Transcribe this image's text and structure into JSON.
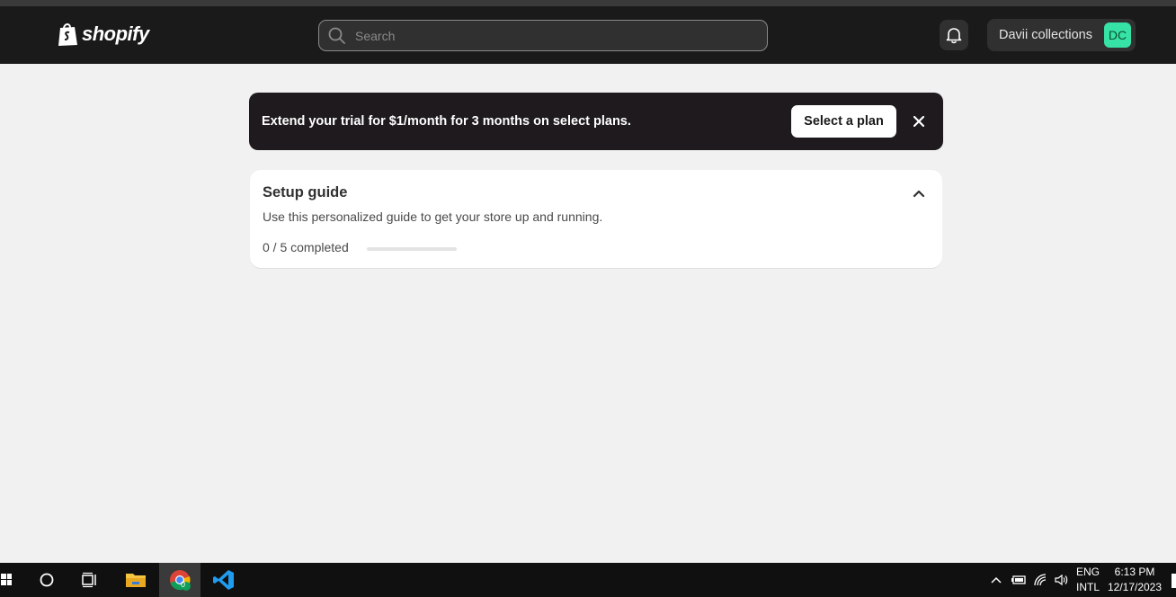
{
  "header": {
    "logo_text": "shopify",
    "search_placeholder": "Search",
    "store_name": "Davii collections",
    "store_initials": "DC"
  },
  "banner": {
    "text": "Extend your trial for $1/month for 3 months on select plans.",
    "button_label": "Select a plan"
  },
  "setup_guide": {
    "title": "Setup guide",
    "subtitle": "Use this personalized guide to get your store up and running.",
    "progress_text": "0 / 5 completed",
    "completed": 0,
    "total": 5
  },
  "taskbar": {
    "language": "ENG",
    "layout": "INTL",
    "time": "6:13 PM",
    "date": "12/17/2023",
    "chrome_badge": "0"
  },
  "colors": {
    "topbar": "#1a1a1a",
    "banner": "#1e1a1d",
    "avatar": "#36e2a5",
    "background": "#f1f1f1"
  }
}
